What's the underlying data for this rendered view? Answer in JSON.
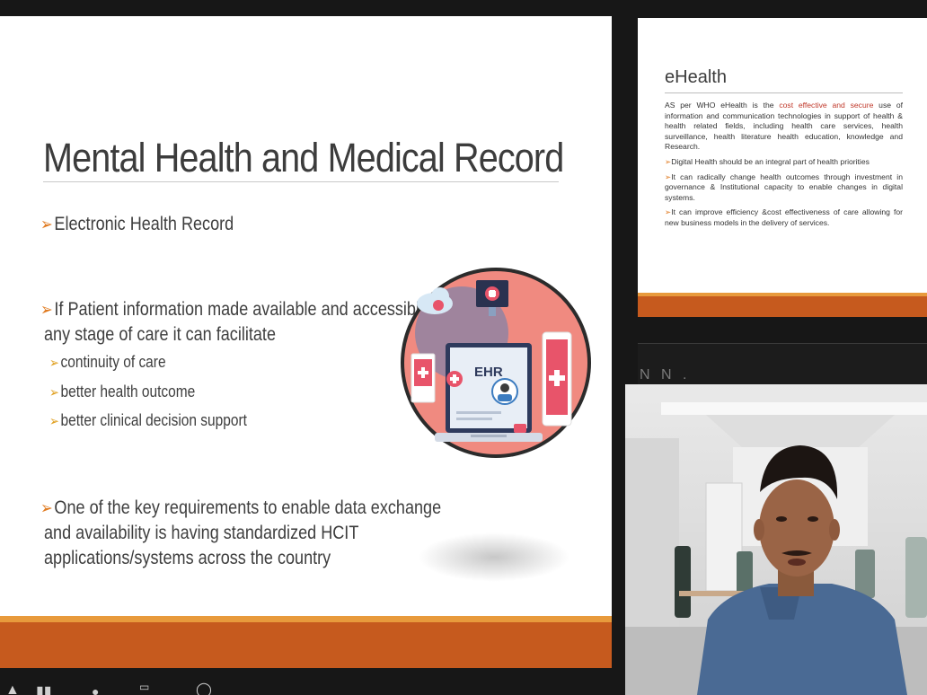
{
  "main_slide": {
    "title": "Mental Health and Medical Record",
    "bullet1": "Electronic Health Record",
    "bullet2_line1": "If Patient information made available and accessible at",
    "bullet2_line2": "any stage of care it can facilitate",
    "subs": [
      "continuity of care",
      "better health outcome",
      "better clinical decision support"
    ],
    "bullet3_line1": "One of the key requirements to enable data exchange",
    "bullet3_line2": "and availability is having standardized HCIT",
    "bullet3_line3": "applications/systems across the country",
    "ehr_label": "EHR"
  },
  "side_slide": {
    "title": "eHealth",
    "intro_pre": "AS per WHO eHealth is the ",
    "intro_red": "cost effective and secure",
    "intro_post": " use of information and communication technologies in support of health & health related fields, including health care services, health surveillance, health literature health education, knowledge and Research.",
    "points": [
      "Digital Health should be an integral part of health priorities",
      "It can radically change health outcomes through investment in governance & Institutional capacity to enable changes in digital systems.",
      "It can improve efficiency &cost effectiveness of care allowing for new business models in the delivery of services."
    ]
  },
  "side_slide2": {
    "label": "N N ."
  },
  "colors": {
    "accent_orange": "#c65a1e",
    "accent_light": "#e89a3c",
    "bullet_arrow": "#e07a1f",
    "illus_circle": "#f08a80"
  }
}
